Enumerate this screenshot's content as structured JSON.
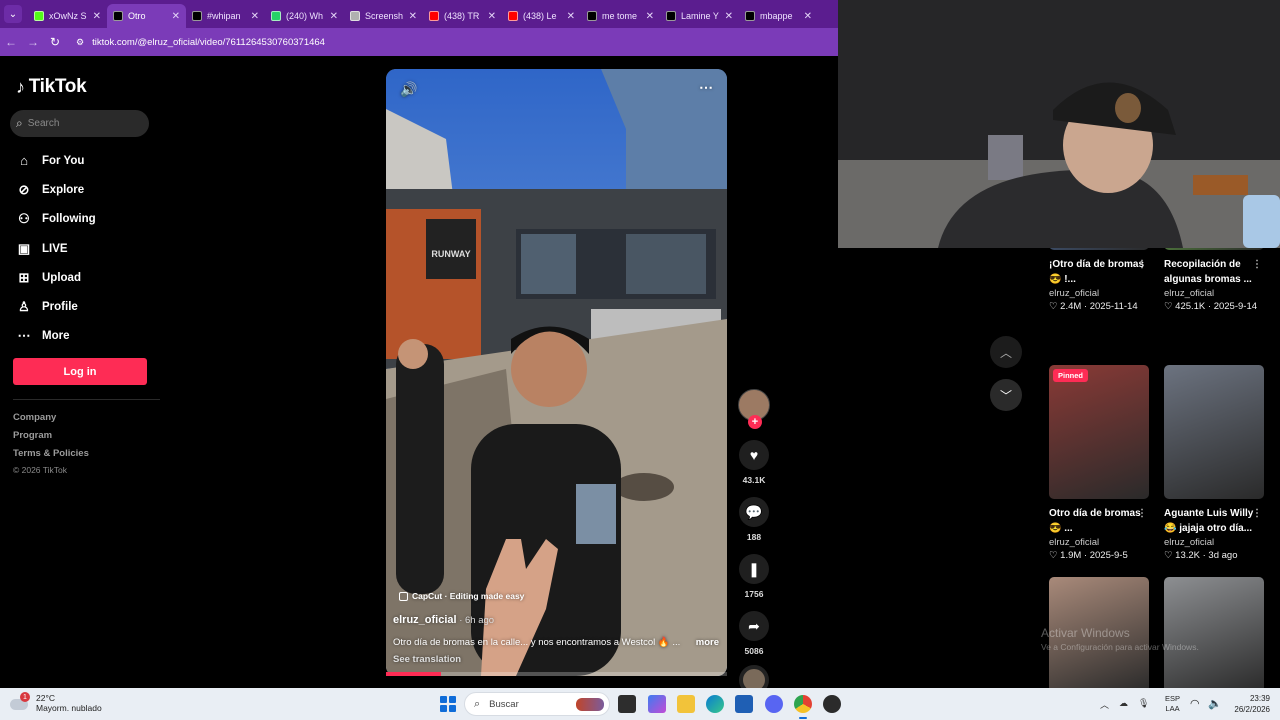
{
  "browser": {
    "tabs": [
      {
        "title": "xOwNz S",
        "favicon": "k-kick-icon",
        "color": "#53fc18",
        "active": false
      },
      {
        "title": "Otro",
        "favicon": "tiktok-icon",
        "color": "#000000",
        "active": true
      },
      {
        "title": "#whipan",
        "favicon": "tiktok-icon",
        "color": "#000000",
        "active": false
      },
      {
        "title": "(240) Wh",
        "favicon": "whatsapp-icon",
        "color": "#25d366",
        "active": false
      },
      {
        "title": "Screensh",
        "favicon": "pen-icon",
        "color": "#b0b0b0",
        "active": false
      },
      {
        "title": "(438) TR",
        "favicon": "youtube-icon",
        "color": "#ff0000",
        "active": false
      },
      {
        "title": "(438) Le",
        "favicon": "youtube-icon",
        "color": "#ff0000",
        "active": false
      },
      {
        "title": "me tome",
        "favicon": "tiktok-icon",
        "color": "#000000",
        "active": false
      },
      {
        "title": "Lamine Y",
        "favicon": "tiktok-icon",
        "color": "#000000",
        "active": false
      },
      {
        "title": "mbappe",
        "favicon": "tiktok-icon",
        "color": "#000000",
        "active": false
      }
    ],
    "url": "tiktok.com/@elruz_oficial/video/7611264530760371464"
  },
  "tiktok": {
    "logo": "TikTok",
    "search_placeholder": "Search",
    "nav": [
      {
        "label": "For You",
        "icon": "home-icon"
      },
      {
        "label": "Explore",
        "icon": "compass-icon"
      },
      {
        "label": "Following",
        "icon": "user-follow-icon"
      },
      {
        "label": "LIVE",
        "icon": "live-icon"
      },
      {
        "label": "Upload",
        "icon": "upload-icon"
      },
      {
        "label": "Profile",
        "icon": "profile-icon"
      },
      {
        "label": "More",
        "icon": "more-icon"
      }
    ],
    "login_label": "Log in",
    "footer_links": [
      "Company",
      "Program",
      "Terms & Policies"
    ],
    "copyright": "© 2026 TikTok"
  },
  "video": {
    "capcut": "CapCut · Editing made easy",
    "author": "elruz_oficial",
    "posted": " · 6h ago",
    "caption": "Otro día de bromas en la calle... y nos encontramos a Westcol 🔥 ...",
    "more_label": "more",
    "see_translation": "See translation",
    "storefront_sign": "RUNWAY",
    "progress": 0.16,
    "actions": {
      "likes": "43.1K",
      "comments": "188",
      "saves": "1756",
      "shares": "5086"
    }
  },
  "grid": {
    "cards": [
      {
        "title": "¡Otro día de bromas 😎 !...",
        "author": "elruz_oficial",
        "meta": "♡ 2.4M · 2025-11-14",
        "pinned": false,
        "color": "#4c6a9a"
      },
      {
        "title": "Recopilación de algunas bromas ...",
        "author": "elruz_oficial",
        "meta": "♡ 425.1K · 2025-9-14",
        "pinned": false,
        "color": "#6bb24a"
      },
      {
        "title": "Otro día de bromas 😎 ...",
        "author": "elruz_oficial",
        "meta": "♡ 1.9M · 2025-9-5",
        "pinned": true,
        "pinned_label": "Pinned",
        "color": "#8a3a36"
      },
      {
        "title": "Aguante Luis Willy 😂 jajaja otro día...",
        "author": "elruz_oficial",
        "meta": "♡ 13.2K · 3d ago",
        "pinned": false,
        "color": "#6c7380"
      },
      {
        "title": "",
        "author": "",
        "meta": "",
        "pinned": false,
        "color": "#a98a7a"
      },
      {
        "title": "",
        "author": "",
        "meta": "",
        "pinned": false,
        "color": "#8d8f92"
      }
    ],
    "watermark_line1": "Activar Windows",
    "watermark_line2": "Ve a Configuración para activar Windows."
  },
  "taskbar": {
    "weather_temp": "22°C",
    "weather_desc": "Mayorm. nublado",
    "weather_badge": "1",
    "search_placeholder": "Buscar",
    "lang_line1": "ESP",
    "lang_line2": "LAA",
    "time": "23:39",
    "date": "26/2/2026"
  }
}
